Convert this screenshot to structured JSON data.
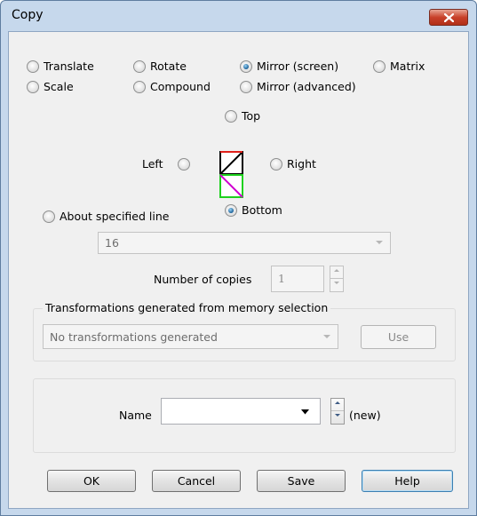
{
  "window": {
    "title": "Copy"
  },
  "modes": [
    {
      "label": "Translate",
      "checked": false
    },
    {
      "label": "Rotate",
      "checked": false
    },
    {
      "label": "Mirror (screen)",
      "checked": true
    },
    {
      "label": "Matrix",
      "checked": false
    },
    {
      "label": "Scale",
      "checked": false
    },
    {
      "label": "Compound",
      "checked": false
    },
    {
      "label": "Mirror (advanced)",
      "checked": false
    }
  ],
  "mirror": {
    "top_label": "Top",
    "left_label": "Left",
    "right_label": "Right",
    "bottom_label": "Bottom",
    "selected": "Bottom",
    "icon": "mirror-diagram-icon"
  },
  "about_line": {
    "label": "About specified line",
    "value": "16"
  },
  "copies": {
    "label": "Number of copies",
    "value": "1"
  },
  "transformations": {
    "group_label": "Transformations generated from memory selection",
    "value": "No transformations generated",
    "use_label": "Use"
  },
  "name": {
    "label": "Name",
    "value": "",
    "suffix": "(new)"
  },
  "buttons": {
    "ok": "OK",
    "cancel": "Cancel",
    "save": "Save",
    "help": "Help"
  },
  "colors": {
    "titlebar": "#c6d8ec",
    "close_button": "#c8412a",
    "dialog_bg": "#f0f0f0"
  }
}
